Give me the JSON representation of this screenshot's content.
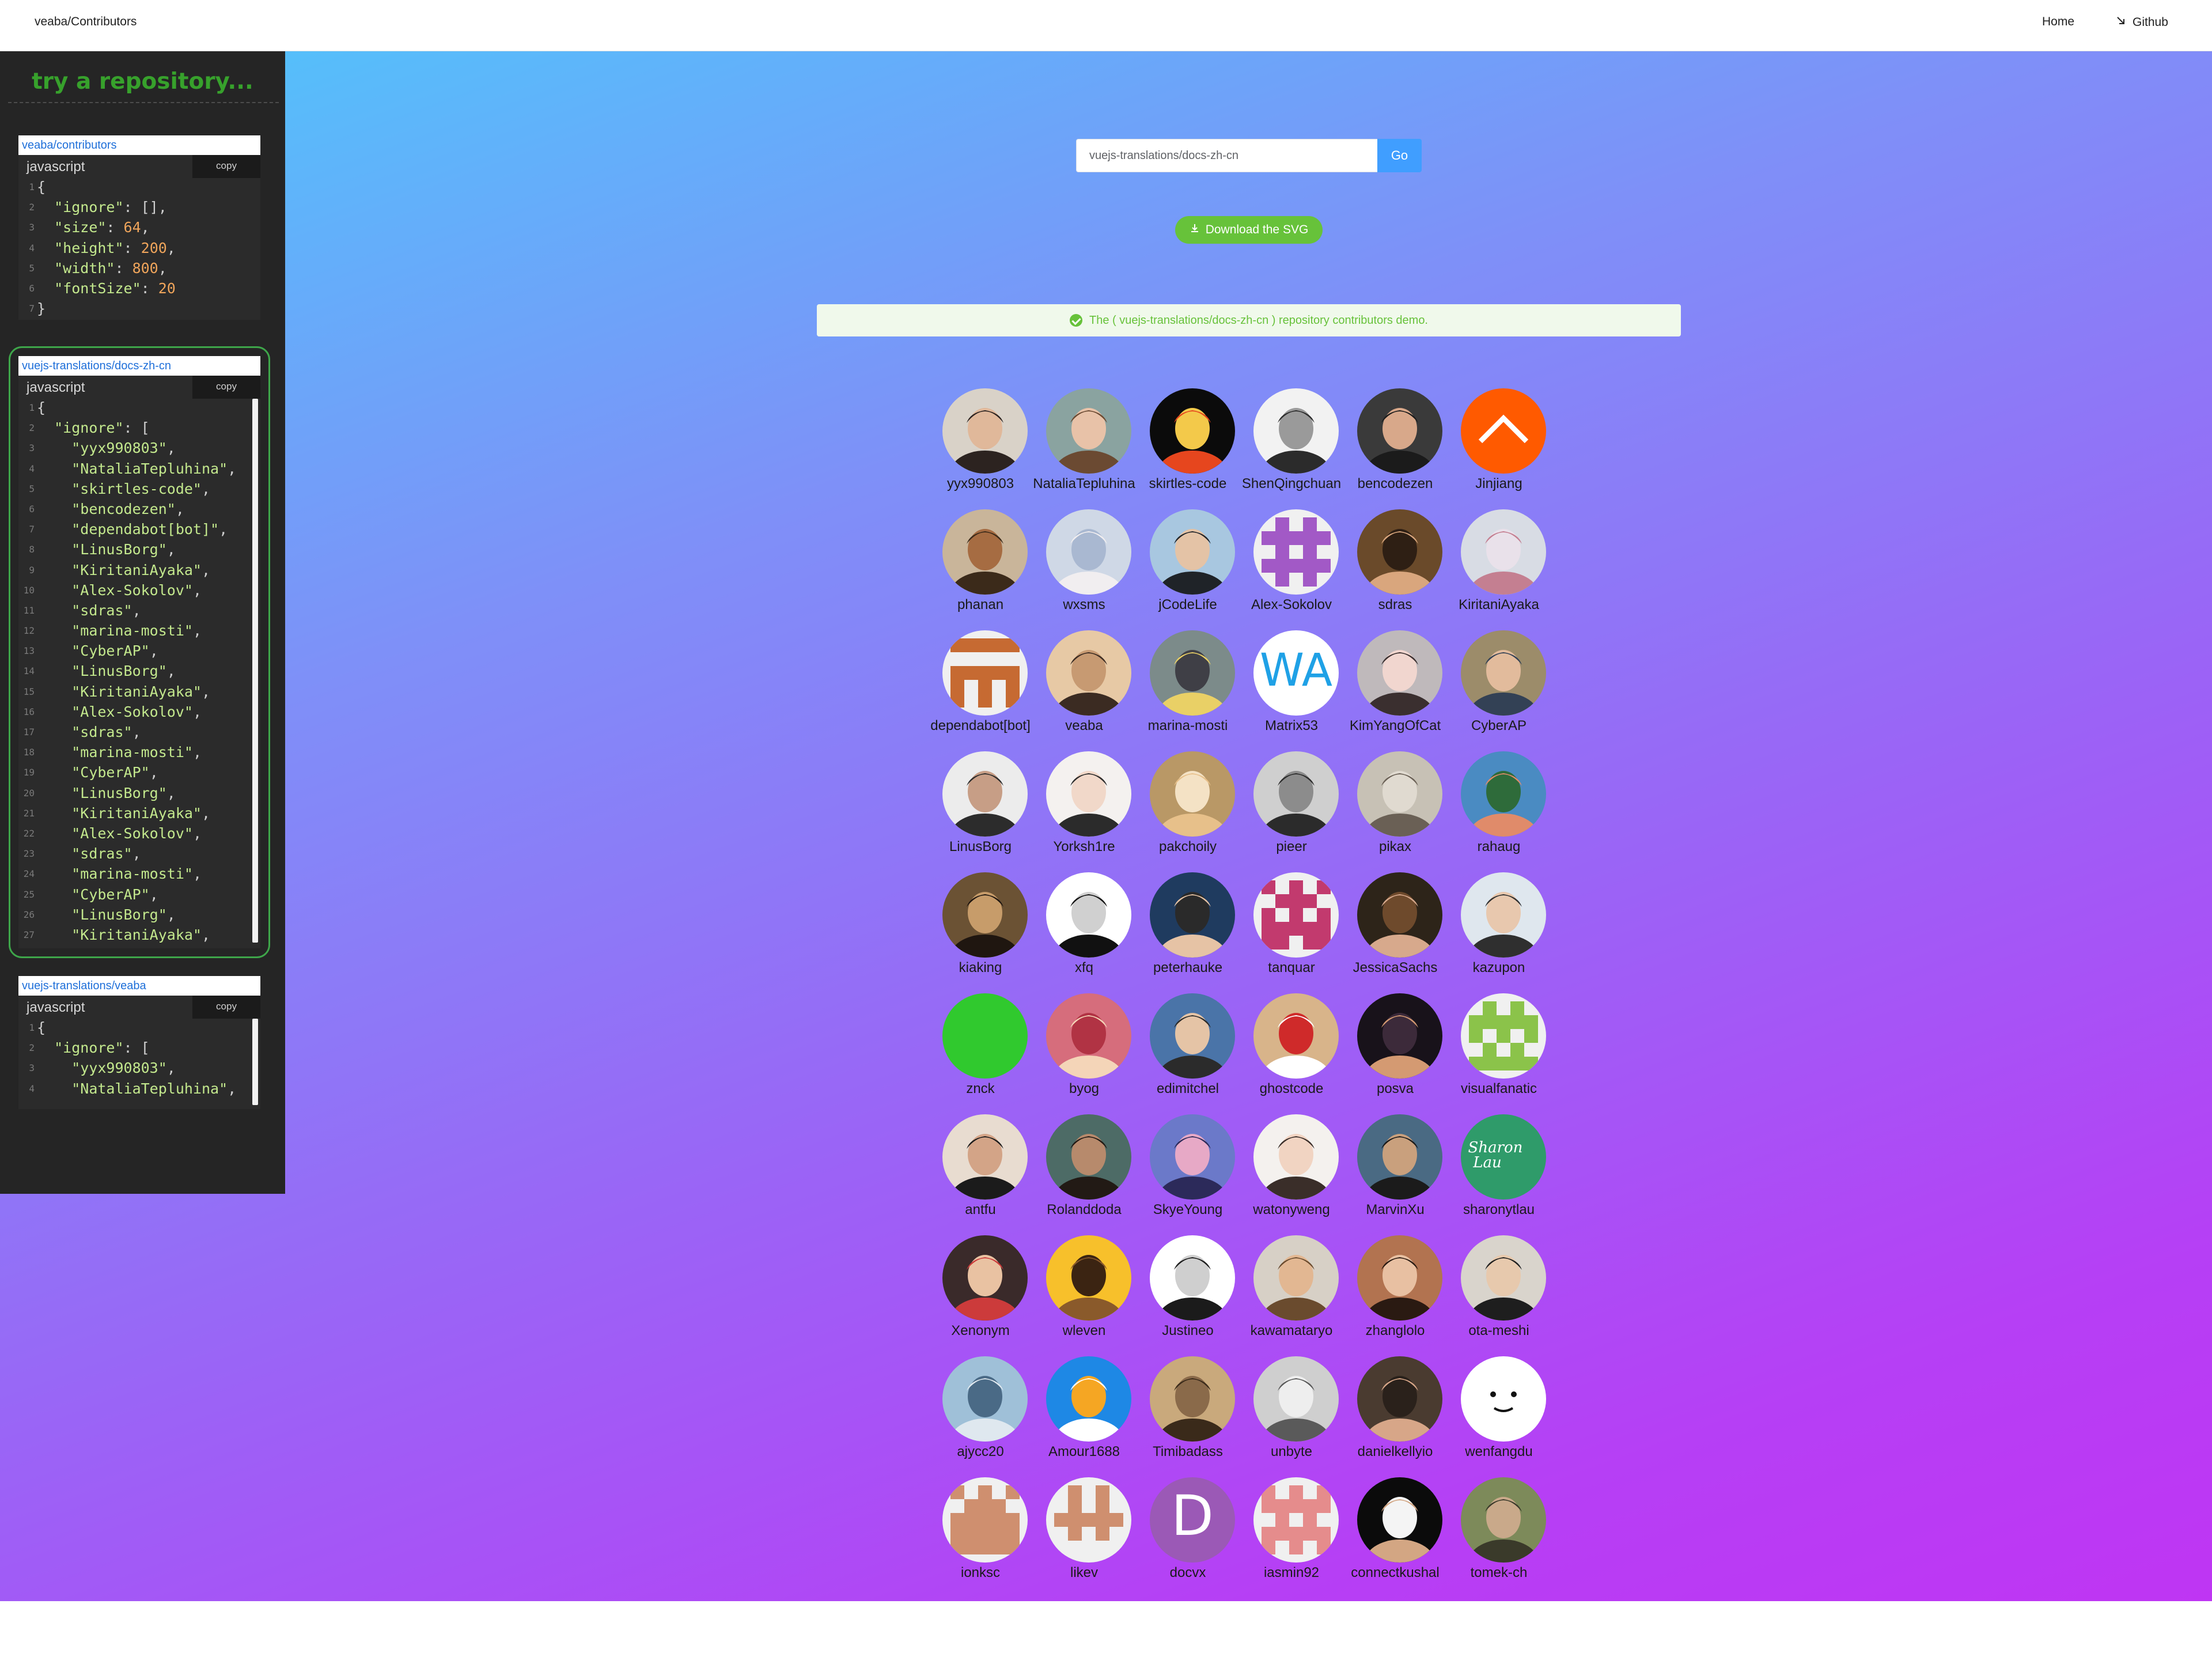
{
  "header": {
    "brand": "veaba/Contributors",
    "nav": {
      "home": "Home",
      "github": "Github"
    }
  },
  "sidebar": {
    "title": "try a repository...",
    "cards": [
      {
        "repo": "veaba/contributors",
        "lang": "javascript",
        "copy": "copy",
        "lines": [
          [
            [
              "p",
              "{"
            ]
          ],
          [
            [
              "p",
              "  "
            ],
            [
              "k",
              "\"ignore\""
            ],
            [
              "p",
              ": [],"
            ]
          ],
          [
            [
              "p",
              "  "
            ],
            [
              "k",
              "\"size\""
            ],
            [
              "p",
              ": "
            ],
            [
              "n",
              "64"
            ],
            [
              "p",
              ","
            ]
          ],
          [
            [
              "p",
              "  "
            ],
            [
              "k",
              "\"height\""
            ],
            [
              "p",
              ": "
            ],
            [
              "n",
              "200"
            ],
            [
              "p",
              ","
            ]
          ],
          [
            [
              "p",
              "  "
            ],
            [
              "k",
              "\"width\""
            ],
            [
              "p",
              ": "
            ],
            [
              "n",
              "800"
            ],
            [
              "p",
              ","
            ]
          ],
          [
            [
              "p",
              "  "
            ],
            [
              "k",
              "\"fontSize\""
            ],
            [
              "p",
              ": "
            ],
            [
              "n",
              "20"
            ]
          ],
          [
            [
              "p",
              "}"
            ]
          ]
        ]
      },
      {
        "repo": "vuejs-translations/docs-zh-cn",
        "lang": "javascript",
        "copy": "copy",
        "lines": [
          [
            [
              "p",
              "{"
            ]
          ],
          [
            [
              "p",
              "  "
            ],
            [
              "k",
              "\"ignore\""
            ],
            [
              "p",
              ": ["
            ]
          ],
          [
            [
              "p",
              "    "
            ],
            [
              "s",
              "\"yyx990803\""
            ],
            [
              "p",
              ","
            ]
          ],
          [
            [
              "p",
              "    "
            ],
            [
              "s",
              "\"NataliaTepluhina\""
            ],
            [
              "p",
              ","
            ]
          ],
          [
            [
              "p",
              "    "
            ],
            [
              "s",
              "\"skirtles-code\""
            ],
            [
              "p",
              ","
            ]
          ],
          [
            [
              "p",
              "    "
            ],
            [
              "s",
              "\"bencodezen\""
            ],
            [
              "p",
              ","
            ]
          ],
          [
            [
              "p",
              "    "
            ],
            [
              "s",
              "\"dependabot[bot]\""
            ],
            [
              "p",
              ","
            ]
          ],
          [
            [
              "p",
              "    "
            ],
            [
              "s",
              "\"LinusBorg\""
            ],
            [
              "p",
              ","
            ]
          ],
          [
            [
              "p",
              "    "
            ],
            [
              "s",
              "\"KiritaniAyaka\""
            ],
            [
              "p",
              ","
            ]
          ],
          [
            [
              "p",
              "    "
            ],
            [
              "s",
              "\"Alex-Sokolov\""
            ],
            [
              "p",
              ","
            ]
          ],
          [
            [
              "p",
              "    "
            ],
            [
              "s",
              "\"sdras\""
            ],
            [
              "p",
              ","
            ]
          ],
          [
            [
              "p",
              "    "
            ],
            [
              "s",
              "\"marina-mosti\""
            ],
            [
              "p",
              ","
            ]
          ],
          [
            [
              "p",
              "    "
            ],
            [
              "s",
              "\"CyberAP\""
            ],
            [
              "p",
              ","
            ]
          ],
          [
            [
              "p",
              "    "
            ],
            [
              "s",
              "\"LinusBorg\""
            ],
            [
              "p",
              ","
            ]
          ],
          [
            [
              "p",
              "    "
            ],
            [
              "s",
              "\"KiritaniAyaka\""
            ],
            [
              "p",
              ","
            ]
          ],
          [
            [
              "p",
              "    "
            ],
            [
              "s",
              "\"Alex-Sokolov\""
            ],
            [
              "p",
              ","
            ]
          ],
          [
            [
              "p",
              "    "
            ],
            [
              "s",
              "\"sdras\""
            ],
            [
              "p",
              ","
            ]
          ],
          [
            [
              "p",
              "    "
            ],
            [
              "s",
              "\"marina-mosti\""
            ],
            [
              "p",
              ","
            ]
          ],
          [
            [
              "p",
              "    "
            ],
            [
              "s",
              "\"CyberAP\""
            ],
            [
              "p",
              ","
            ]
          ],
          [
            [
              "p",
              "    "
            ],
            [
              "s",
              "\"LinusBorg\""
            ],
            [
              "p",
              ","
            ]
          ],
          [
            [
              "p",
              "    "
            ],
            [
              "s",
              "\"KiritaniAyaka\""
            ],
            [
              "p",
              ","
            ]
          ],
          [
            [
              "p",
              "    "
            ],
            [
              "s",
              "\"Alex-Sokolov\""
            ],
            [
              "p",
              ","
            ]
          ],
          [
            [
              "p",
              "    "
            ],
            [
              "s",
              "\"sdras\""
            ],
            [
              "p",
              ","
            ]
          ],
          [
            [
              "p",
              "    "
            ],
            [
              "s",
              "\"marina-mosti\""
            ],
            [
              "p",
              ","
            ]
          ],
          [
            [
              "p",
              "    "
            ],
            [
              "s",
              "\"CyberAP\""
            ],
            [
              "p",
              ","
            ]
          ],
          [
            [
              "p",
              "    "
            ],
            [
              "s",
              "\"LinusBorg\""
            ],
            [
              "p",
              ","
            ]
          ],
          [
            [
              "p",
              "    "
            ],
            [
              "s",
              "\"KiritaniAyaka\""
            ],
            [
              "p",
              ","
            ]
          ]
        ]
      },
      {
        "repo": "vuejs-translations/veaba",
        "lang": "javascript",
        "copy": "copy",
        "lines": [
          [
            [
              "p",
              "{"
            ]
          ],
          [
            [
              "p",
              "  "
            ],
            [
              "k",
              "\"ignore\""
            ],
            [
              "p",
              ": ["
            ]
          ],
          [
            [
              "p",
              "    "
            ],
            [
              "s",
              "\"yyx990803\""
            ],
            [
              "p",
              ","
            ]
          ],
          [
            [
              "p",
              "    "
            ],
            [
              "s",
              "\"NataliaTepluhina\""
            ],
            [
              "p",
              ","
            ]
          ]
        ]
      }
    ]
  },
  "search": {
    "value": "vuejs-translations/docs-zh-cn",
    "go_label": "Go"
  },
  "download_label": "Download the SVG",
  "alert_text": "The ( vuejs-translations/docs-zh-cn ) repository contributors demo.",
  "contributors": [
    {
      "name": "yyx990803",
      "kind": "photo",
      "colors": [
        "#d9d2c8",
        "#2c2320",
        "#e0b89a"
      ]
    },
    {
      "name": "NataliaTepluhina",
      "kind": "photo",
      "colors": [
        "#8aa3a0",
        "#6b4a32",
        "#e8c2a8"
      ]
    },
    {
      "name": "skirtles-code",
      "kind": "photo",
      "colors": [
        "#0b0b0b",
        "#e6461e",
        "#f3c94a"
      ]
    },
    {
      "name": "ShenQingchuan",
      "kind": "photo",
      "colors": [
        "#f2f2f2",
        "#2b2b2b",
        "#9a9a9a"
      ]
    },
    {
      "name": "bencodezen",
      "kind": "photo",
      "colors": [
        "#3a3a3a",
        "#1b1b1b",
        "#d8a88a"
      ]
    },
    {
      "name": "Jinjiang",
      "kind": "chevron",
      "colors": [
        "#ff5a00",
        "#ffffff"
      ]
    },
    {
      "name": "phanan",
      "kind": "photo",
      "colors": [
        "#c9b59a",
        "#3b2a1a",
        "#a66c42"
      ]
    },
    {
      "name": "wxsms",
      "kind": "photo",
      "colors": [
        "#cfd8e6",
        "#f1eef0",
        "#a9b8d1"
      ]
    },
    {
      "name": "jCodeLife",
      "kind": "photo",
      "colors": [
        "#a8c7e0",
        "#1f2328",
        "#e4c3a6"
      ]
    },
    {
      "name": "Alex-Sokolov",
      "kind": "identicon",
      "colors": [
        "#a259c6",
        "#ffffff"
      ],
      "pattern": [
        0,
        1,
        0,
        1,
        1,
        1,
        0,
        1,
        0,
        1,
        1,
        1,
        0,
        1,
        0
      ]
    },
    {
      "name": "sdras",
      "kind": "photo",
      "colors": [
        "#6a4a2a",
        "#d9a67d",
        "#2e1f14"
      ]
    },
    {
      "name": "KiritaniAyaka",
      "kind": "photo",
      "colors": [
        "#d8dce4",
        "#c47f91",
        "#e9e1ea"
      ]
    },
    {
      "name": "dependabot[bot]",
      "kind": "identicon",
      "colors": [
        "#c66a32",
        "#ffffff"
      ],
      "pattern": [
        1,
        1,
        1,
        0,
        0,
        0,
        1,
        1,
        1,
        1,
        0,
        1,
        1,
        0,
        1
      ]
    },
    {
      "name": "veaba",
      "kind": "photo",
      "colors": [
        "#e7c9a5",
        "#3b2b22",
        "#c79a72"
      ]
    },
    {
      "name": "marina-mosti",
      "kind": "photo",
      "colors": [
        "#7c8b8a",
        "#e9d066",
        "#3f3f46"
      ]
    },
    {
      "name": "Matrix53",
      "kind": "letters",
      "colors": [
        "#ffffff",
        "#1fa1e6"
      ],
      "text": "WA"
    },
    {
      "name": "KimYangOfCat",
      "kind": "photo",
      "colors": [
        "#bfb9bb",
        "#3a2f2f",
        "#f1d6cf"
      ]
    },
    {
      "name": "CyberAP",
      "kind": "photo",
      "colors": [
        "#9c8c6a",
        "#334155",
        "#e2bb9c"
      ]
    },
    {
      "name": "LinusBorg",
      "kind": "photo",
      "colors": [
        "#ececec",
        "#2c2c2c",
        "#c79e86"
      ]
    },
    {
      "name": "Yorksh1re",
      "kind": "photo",
      "colors": [
        "#f4f1ef",
        "#2b2b2b",
        "#f1d8c9"
      ]
    },
    {
      "name": "pakchoily",
      "kind": "photo",
      "colors": [
        "#b99866",
        "#e7c08a",
        "#f4e2c5"
      ]
    },
    {
      "name": "pieer",
      "kind": "photo",
      "colors": [
        "#cfcfcf",
        "#2b2b2b",
        "#8c8c8c"
      ]
    },
    {
      "name": "pikax",
      "kind": "photo",
      "colors": [
        "#c7c1b5",
        "#6a6055",
        "#e0dad0"
      ]
    },
    {
      "name": "rahaug",
      "kind": "photo",
      "colors": [
        "#4a8bc2",
        "#e08b6a",
        "#2e6b3a"
      ]
    },
    {
      "name": "kiaking",
      "kind": "photo",
      "colors": [
        "#6b5234",
        "#1f1610",
        "#c79c6a"
      ]
    },
    {
      "name": "xfq",
      "kind": "photo",
      "colors": [
        "#ffffff",
        "#111111",
        "#d0d0d0"
      ]
    },
    {
      "name": "peterhauke",
      "kind": "photo",
      "colors": [
        "#1f3b5f",
        "#e6c3a5",
        "#2a2a2a"
      ]
    },
    {
      "name": "tanquar",
      "kind": "identicon",
      "colors": [
        "#c23a6e",
        "#ffffff"
      ],
      "pattern": [
        1,
        0,
        1,
        0,
        1,
        1,
        1,
        0,
        1,
        1,
        1,
        1,
        1,
        1,
        0
      ]
    },
    {
      "name": "JessicaSachs",
      "kind": "photo",
      "colors": [
        "#2d2419",
        "#d7a98c",
        "#6e4a2c"
      ]
    },
    {
      "name": "kazupon",
      "kind": "photo",
      "colors": [
        "#dfe7ee",
        "#2f2f2f",
        "#e8c8ae"
      ]
    },
    {
      "name": "znck",
      "kind": "solid",
      "colors": [
        "#30c92e"
      ]
    },
    {
      "name": "byog",
      "kind": "photo",
      "colors": [
        "#d66d7c",
        "#f4d5b8",
        "#b13344"
      ]
    },
    {
      "name": "edimitchel",
      "kind": "photo",
      "colors": [
        "#4a74a8",
        "#2b2b2b",
        "#e5c4a6"
      ]
    },
    {
      "name": "ghostcode",
      "kind": "photo",
      "colors": [
        "#d8b48a",
        "#ffffff",
        "#cf2a2a"
      ]
    },
    {
      "name": "posva",
      "kind": "photo",
      "colors": [
        "#18121a",
        "#d49a72",
        "#3c2a3a"
      ]
    },
    {
      "name": "visualfanatic",
      "kind": "identicon",
      "colors": [
        "#8bc34a",
        "#ffffff"
      ],
      "pattern": [
        0,
        1,
        0,
        1,
        1,
        1,
        1,
        0,
        1,
        0,
        1,
        0,
        1,
        1,
        1
      ]
    },
    {
      "name": "antfu",
      "kind": "photo",
      "colors": [
        "#e8dcd0",
        "#1b1b1b",
        "#d3a487"
      ]
    },
    {
      "name": "Rolanddoda",
      "kind": "photo",
      "colors": [
        "#4d6b66",
        "#221a15",
        "#b78a6c"
      ]
    },
    {
      "name": "SkyeYoung",
      "kind": "photo",
      "colors": [
        "#6b79c9",
        "#2c2a5a",
        "#e7a9c6"
      ]
    },
    {
      "name": "watonyweng",
      "kind": "photo",
      "colors": [
        "#f4f1ee",
        "#3a2e29",
        "#f1d4c2"
      ]
    },
    {
      "name": "MarvinXu",
      "kind": "photo",
      "colors": [
        "#4a6a83",
        "#1b1b1b",
        "#c9a07d"
      ]
    },
    {
      "name": "sharonytlau",
      "kind": "script",
      "colors": [
        "#2f9b6a",
        "#ffffff"
      ],
      "text": "Sharon Lau"
    },
    {
      "name": "Xenonym",
      "kind": "photo",
      "colors": [
        "#3a2a2a",
        "#cc3b3b",
        "#e9c2a2"
      ]
    },
    {
      "name": "wleven",
      "kind": "photo",
      "colors": [
        "#f7c02b",
        "#8a5a2b",
        "#3b2412"
      ]
    },
    {
      "name": "Justineo",
      "kind": "photo",
      "colors": [
        "#ffffff",
        "#1b1b1b",
        "#cfcfcf"
      ]
    },
    {
      "name": "kawamataryo",
      "kind": "photo",
      "colors": [
        "#d7d0c6",
        "#6a4b2e",
        "#e2b792"
      ]
    },
    {
      "name": "zhanglolo",
      "kind": "photo",
      "colors": [
        "#b27350",
        "#2a1a12",
        "#e8c0a2"
      ]
    },
    {
      "name": "ota-meshi",
      "kind": "photo",
      "colors": [
        "#d9d4cc",
        "#1e1e1e",
        "#e7c9ad"
      ]
    },
    {
      "name": "ajycc20",
      "kind": "photo",
      "colors": [
        "#9fc0d8",
        "#dfe8ef",
        "#4a6a86"
      ]
    },
    {
      "name": "Amour1688",
      "kind": "photo",
      "colors": [
        "#1e88e5",
        "#ffffff",
        "#f5a623"
      ]
    },
    {
      "name": "Timibadass",
      "kind": "photo",
      "colors": [
        "#c9a97c",
        "#3a2a1a",
        "#8a6a4a"
      ]
    },
    {
      "name": "unbyte",
      "kind": "photo",
      "colors": [
        "#cfcfcf",
        "#5a5a5a",
        "#eeeeee"
      ]
    },
    {
      "name": "danielkellyio",
      "kind": "photo",
      "colors": [
        "#4a3b30",
        "#d7a688",
        "#2a211b"
      ]
    },
    {
      "name": "wenfangdu",
      "kind": "face",
      "colors": [
        "#ffffff",
        "#111111"
      ]
    },
    {
      "name": "ionksc",
      "kind": "identicon",
      "colors": [
        "#cf8f6f",
        "#ffffff"
      ],
      "pattern": [
        1,
        0,
        1,
        0,
        1,
        1,
        1,
        1,
        1,
        1,
        1,
        1,
        1,
        1,
        1
      ]
    },
    {
      "name": "likev",
      "kind": "identicon",
      "colors": [
        "#cf8f6f",
        "#ffffff"
      ],
      "pattern": [
        0,
        1,
        0,
        0,
        1,
        0,
        1,
        1,
        1,
        0,
        1,
        0,
        0,
        0,
        0
      ]
    },
    {
      "name": "docvx",
      "kind": "letters",
      "colors": [
        "#9b59b6",
        "#ffffff"
      ],
      "text": "D"
    },
    {
      "name": "iasmin92",
      "kind": "identicon",
      "colors": [
        "#e58c8c",
        "#ffffff"
      ],
      "pattern": [
        1,
        0,
        1,
        1,
        1,
        1,
        0,
        1,
        0,
        1,
        1,
        1,
        1,
        0,
        1
      ]
    },
    {
      "name": "connectkushal",
      "kind": "photo",
      "colors": [
        "#0b0b0b",
        "#d3a683",
        "#f4f4f4"
      ]
    },
    {
      "name": "tomek-ch",
      "kind": "photo",
      "colors": [
        "#7d8a5a",
        "#3a3a2a",
        "#c9a98a"
      ]
    }
  ]
}
